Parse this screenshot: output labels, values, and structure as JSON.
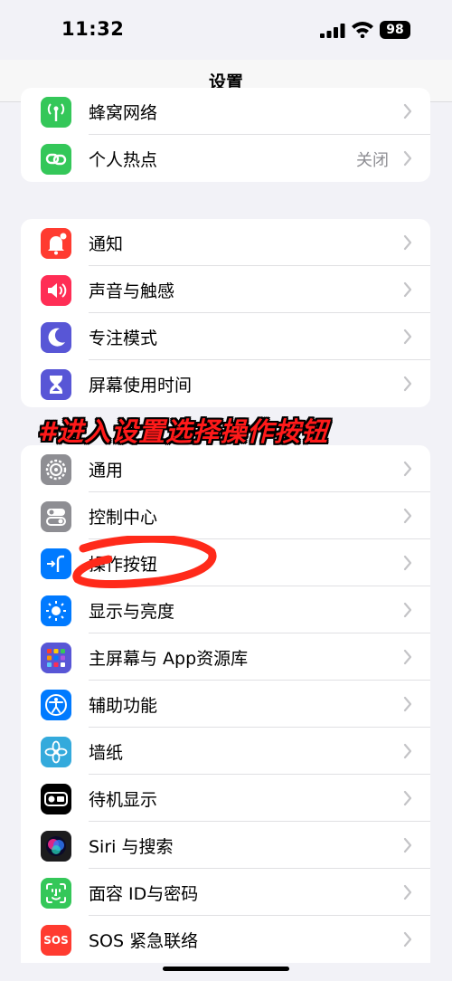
{
  "status": {
    "time": "11:32",
    "battery": "98"
  },
  "nav": {
    "title": "设置"
  },
  "overlay": {
    "text": "#进入设置选择操作按钮"
  },
  "groups": {
    "connectivity": [
      {
        "label": "蜂窝网络",
        "icon": "cellular-antenna-icon",
        "color": "#34c759"
      },
      {
        "label": "个人热点",
        "value": "关闭",
        "icon": "hotspot-chain-icon",
        "color": "#34c759"
      }
    ],
    "attention": [
      {
        "label": "通知",
        "icon": "bell-icon",
        "color": "#ff3b30"
      },
      {
        "label": "声音与触感",
        "icon": "speaker-icon",
        "color": "#ff2d55"
      },
      {
        "label": "专注模式",
        "icon": "moon-icon",
        "color": "#5856d6"
      },
      {
        "label": "屏幕使用时间",
        "icon": "hourglass-icon",
        "color": "#5856d6"
      }
    ],
    "general": [
      {
        "label": "通用",
        "icon": "gear-icon",
        "color": "#8e8e93"
      },
      {
        "label": "控制中心",
        "icon": "toggles-icon",
        "color": "#8e8e93"
      },
      {
        "label": "操作按钮",
        "icon": "action-button-icon",
        "color": "#007aff"
      },
      {
        "label": "显示与亮度",
        "icon": "sun-icon",
        "color": "#007aff"
      },
      {
        "label": "主屏幕与 App资源库",
        "icon": "app-grid-icon",
        "color": "#5856d6"
      },
      {
        "label": "辅助功能",
        "icon": "accessibility-icon",
        "color": "#007aff"
      },
      {
        "label": "墙纸",
        "icon": "flower-icon",
        "color": "#34aadc"
      },
      {
        "label": "待机显示",
        "icon": "standby-icon",
        "color": "#000000"
      },
      {
        "label": "Siri 与搜索",
        "icon": "siri-icon",
        "color": "#1c1c1e"
      },
      {
        "label": "面容 ID与密码",
        "icon": "face-id-icon",
        "color": "#34c759"
      },
      {
        "label": "SOS 紧急联络",
        "icon": "sos-text-icon",
        "sosText": "SOS",
        "color": "#ff3b30"
      }
    ]
  },
  "colors": {
    "overlay_text": "#ff1a1a",
    "scribble": "#ff2a1a",
    "chevron": "#c4c4c7"
  }
}
